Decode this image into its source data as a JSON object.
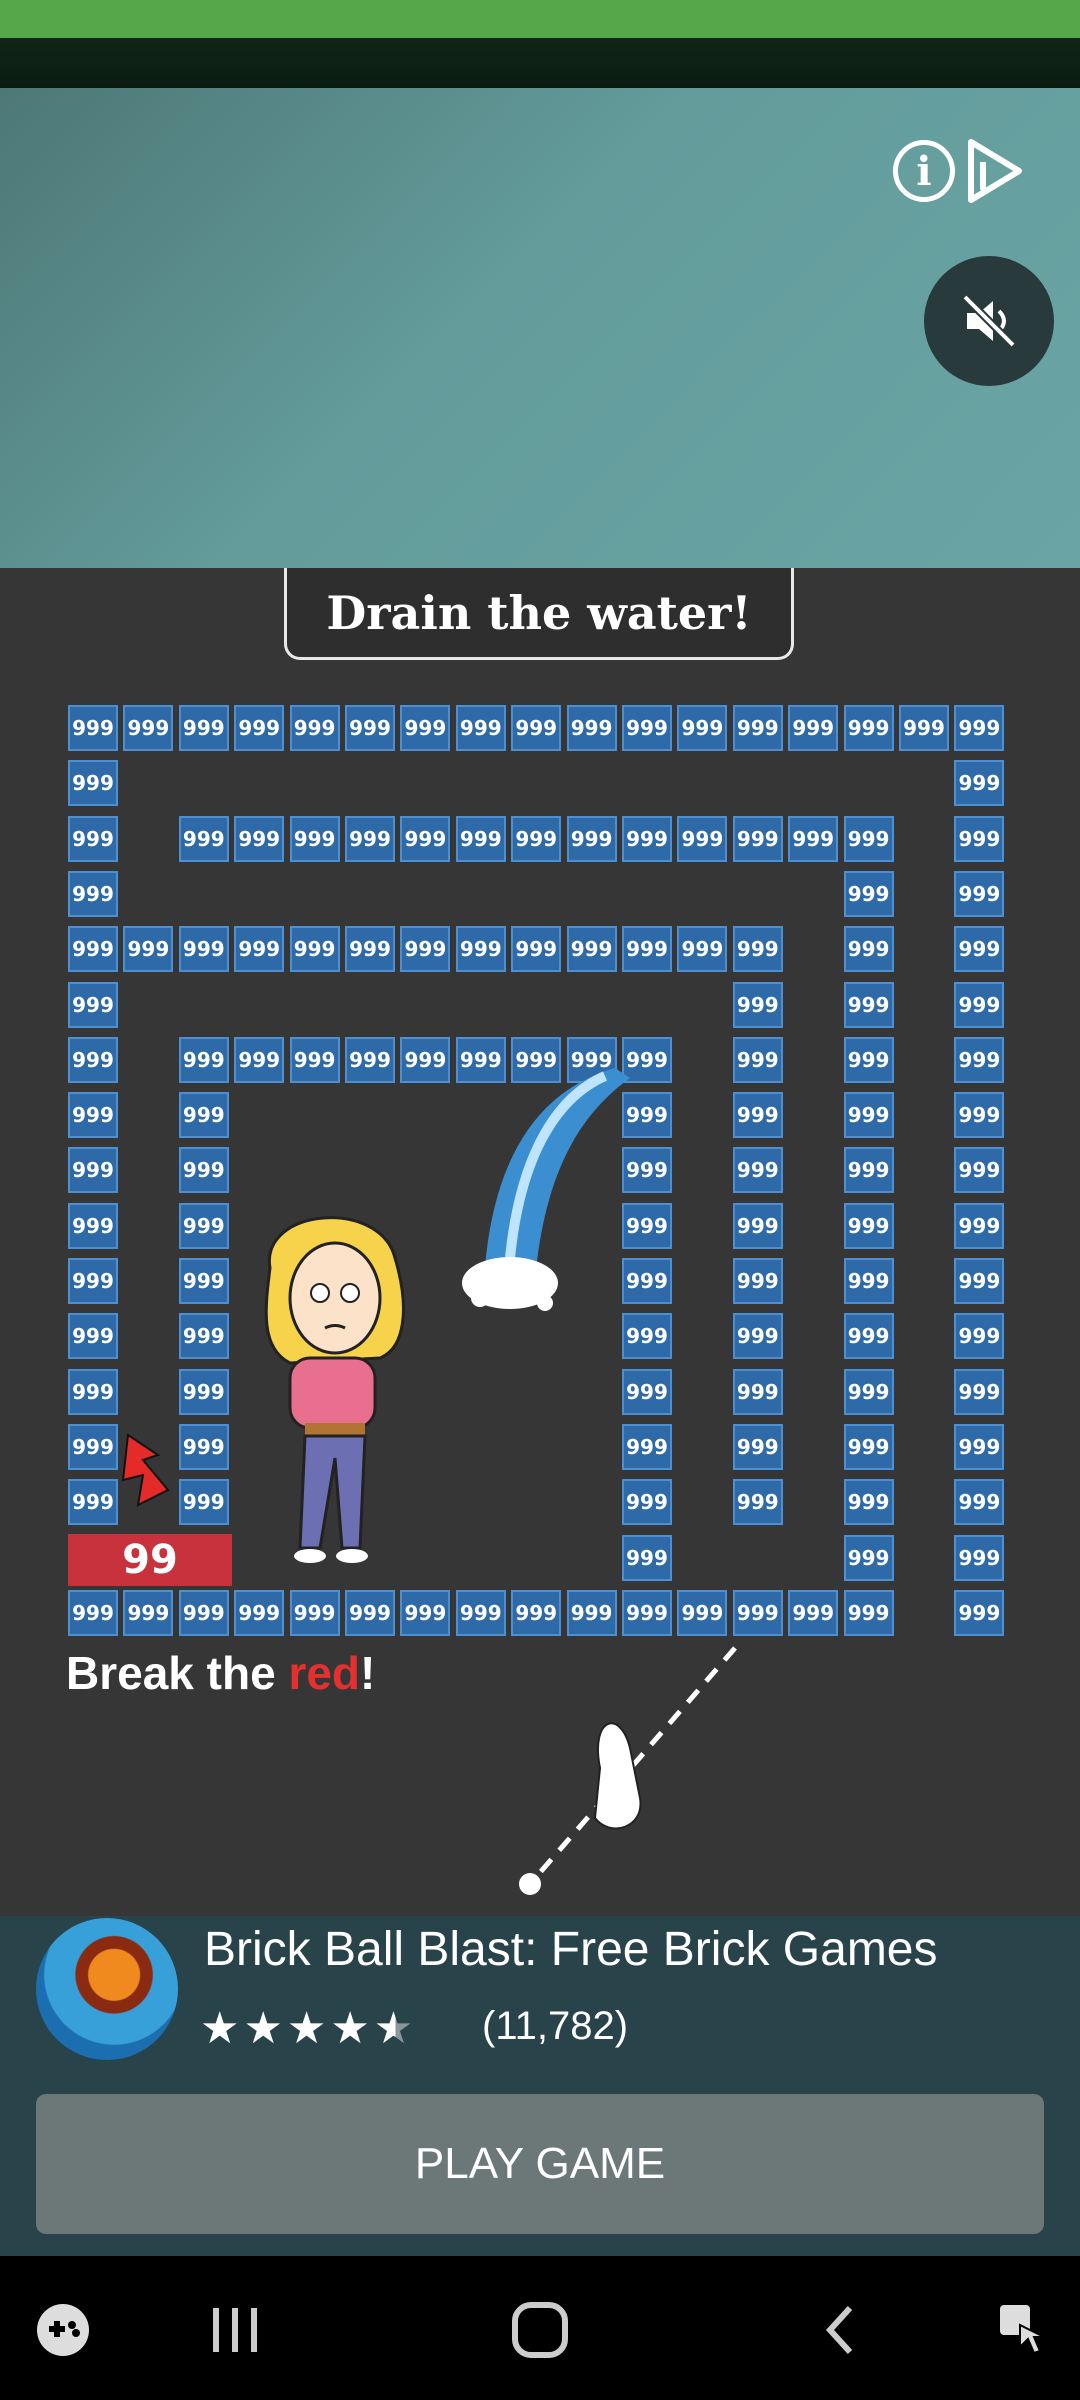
{
  "game": {
    "banner_text": "Drain the water!",
    "block_value": "999",
    "red_block_value": "99",
    "hint_prefix": "Break the ",
    "hint_red": "red",
    "hint_suffix": "!"
  },
  "ad": {
    "app_title": "Brick Ball Blast: Free Brick Games",
    "stars_text": "★★★★",
    "rating": 4.5,
    "rating_count": "(11,782)",
    "cta_label": "PLAY GAME"
  },
  "icons": {
    "info": "info-icon",
    "adchoices": "adchoices-icon",
    "mute": "mute-icon",
    "game_launcher": "gamepad-icon",
    "recents": "recents-icon",
    "home": "home-icon",
    "back": "back-icon",
    "accessibility": "accessibility-icon"
  },
  "colors": {
    "block": "#2f6aa8",
    "red_block": "#c8323c",
    "background": "#363636"
  }
}
